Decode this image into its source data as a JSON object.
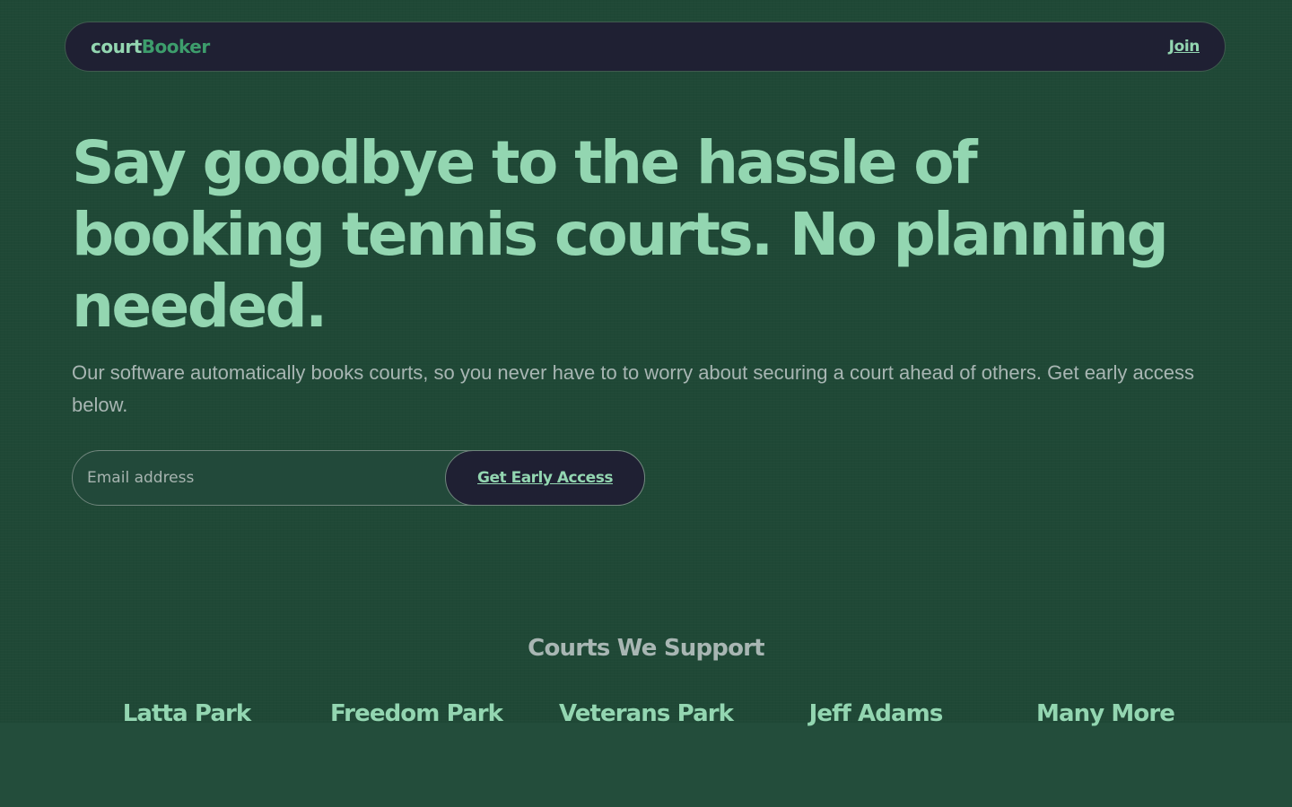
{
  "nav": {
    "logo_part1": "court",
    "logo_part2": "Booker",
    "join_label": "Join"
  },
  "hero": {
    "title": "Say goodbye to the hassle of booking tennis courts. No planning needed.",
    "subtitle": "Our software automatically books courts, so you never have to to worry about securing a court ahead of others. Get early access below."
  },
  "signup": {
    "email_placeholder": "Email address",
    "button_label": "Get Early Access"
  },
  "courts": {
    "heading": "Courts We Support",
    "items": [
      "Latta Park",
      "Freedom Park",
      "Veterans Park",
      "Jeff Adams",
      "Many More"
    ]
  },
  "colors": {
    "background": "#1f4836",
    "accent": "#93d6b1",
    "accent_dark": "#3d9d6c",
    "navbar": "#1f2033",
    "muted_text": "#a8b6b3"
  }
}
